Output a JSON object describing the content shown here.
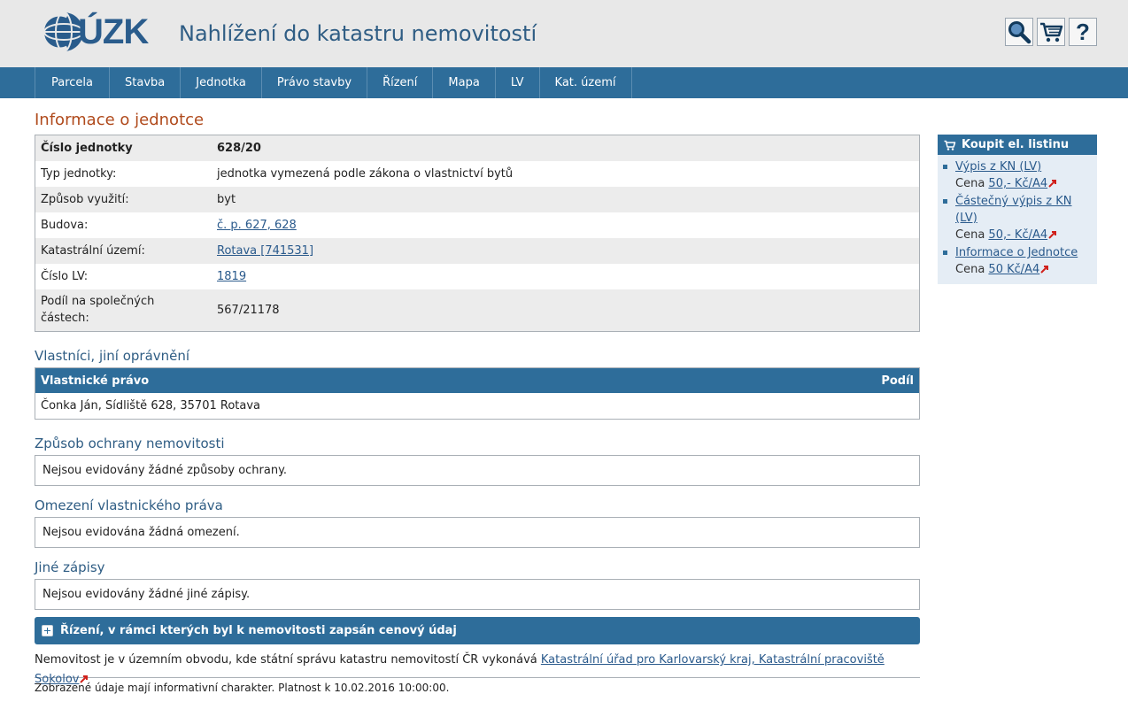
{
  "header": {
    "logo_text": "ÚZK",
    "app_title": "Nahlížení do katastru nemovitostí",
    "icons": [
      "search-icon",
      "cart-icon",
      "help-icon"
    ],
    "help_glyph": "?"
  },
  "nav": {
    "items": [
      "Parcela",
      "Stavba",
      "Jednotka",
      "Právo stavby",
      "Řízení",
      "Mapa",
      "LV",
      "Kat. území"
    ]
  },
  "page": {
    "title": "Informace o jednotce"
  },
  "unit_info": {
    "rows": [
      {
        "label": "Číslo jednotky",
        "value": "628/20"
      },
      {
        "label": "Typ jednotky:",
        "value": "jednotka vymezená podle zákona o vlastnictví bytů"
      },
      {
        "label": "Způsob využití:",
        "value": "byt"
      },
      {
        "label": "Budova:",
        "value": "č. p. 627, 628"
      },
      {
        "label": "Katastrální území:",
        "value": "Rotava [741531]"
      },
      {
        "label": "Číslo LV:",
        "value": "1819"
      },
      {
        "label": "Podíl na společných částech:",
        "value": "567/21178"
      }
    ]
  },
  "owners": {
    "section_title": "Vlastníci, jiní oprávnění",
    "col_right": "Vlastnické právo",
    "col_share": "Podíl",
    "rows": [
      {
        "name": "Čonka Ján, Sídliště 628, 35701 Rotava",
        "share": ""
      }
    ]
  },
  "protection": {
    "section_title": "Způsob ochrany nemovitosti",
    "text": "Nejsou evidovány žádné způsoby ochrany."
  },
  "restrictions": {
    "section_title": "Omezení vlastnického práva",
    "text": "Nejsou evidována žádná omezení."
  },
  "other": {
    "section_title": "Jiné zápisy",
    "text": "Nejsou evidovány žádné jiné zápisy."
  },
  "proceedings_bar": {
    "label": "Řízení, v rámci kterých byl k nemovitosti zapsán cenový údaj"
  },
  "office_note": {
    "text": "Nemovitost je v územním obvodu, kde státní správu katastru nemovitostí ČR vykonává ",
    "link": "Katastrální úřad pro Karlovarský kraj, Katastrální pracoviště Sokolov"
  },
  "footer": {
    "text": "Zobrazené údaje mají informativní charakter. Platnost k 10.02.2016 10:00:00."
  },
  "sidebar": {
    "title": "Koupit el. listinu",
    "items": [
      {
        "label": "Výpis z KN (LV)",
        "price_prefix": "Cena ",
        "price": "50,- Kč/A4"
      },
      {
        "label": "Částečný výpis z KN (LV)",
        "price_prefix": "Cena ",
        "price": "50,- Kč/A4"
      },
      {
        "label": "Informace o Jednotce",
        "price_prefix": "Cena ",
        "price": "50 Kč/A4"
      }
    ]
  },
  "colors": {
    "header_bg": "#e8e8e8",
    "nav_bg": "#2e6d9a",
    "title_orange": "#b04a1c",
    "section_blue": "#2f5d84",
    "ext_arrow": "#d0201a"
  }
}
